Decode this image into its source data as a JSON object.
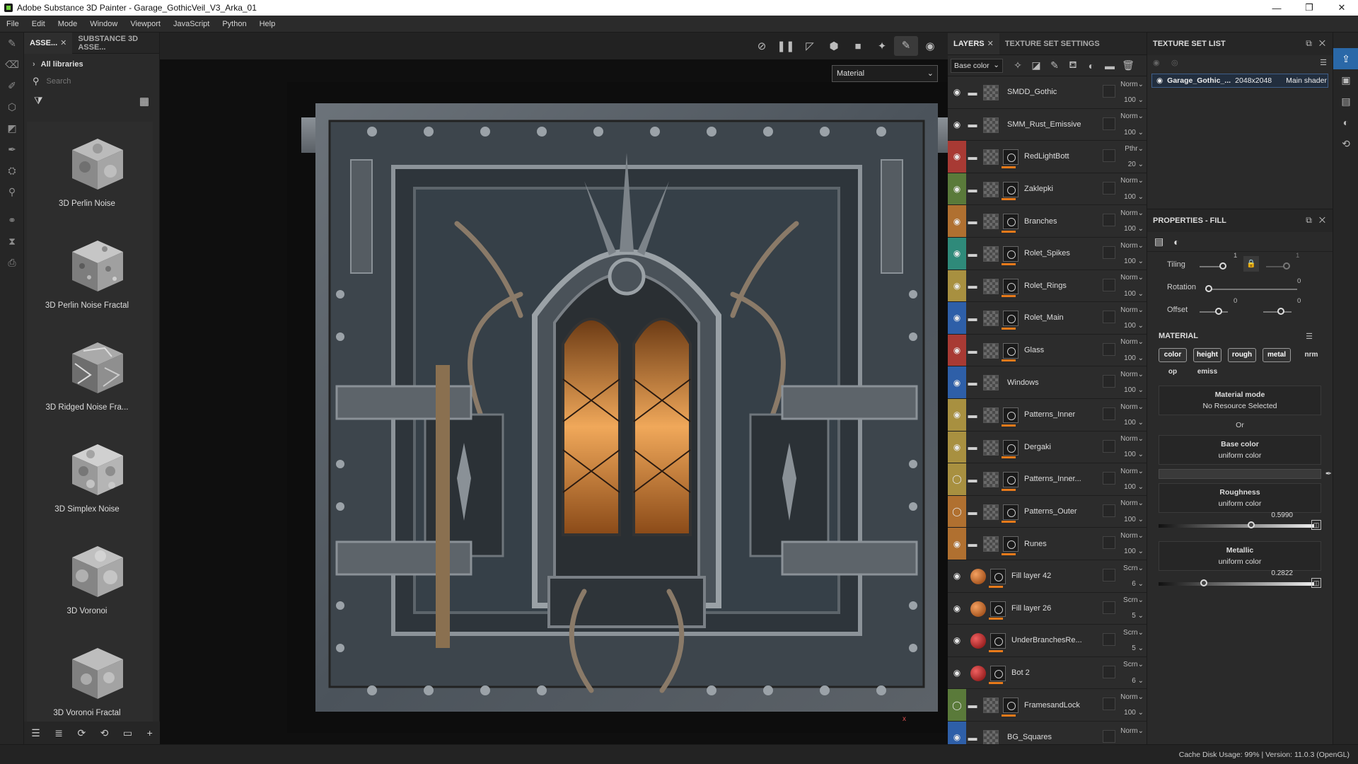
{
  "window": {
    "title": "Adobe Substance 3D Painter - Garage_GothicVeil_V3_Arka_01",
    "controls": [
      "—",
      "❐",
      "✕"
    ]
  },
  "menu": [
    "File",
    "Edit",
    "Mode",
    "Window",
    "Viewport",
    "JavaScript",
    "Python",
    "Help"
  ],
  "assets": {
    "tabs": [
      "ASSE...",
      "SUBSTANCE 3D ASSE..."
    ],
    "library": "All libraries",
    "search_placeholder": "Search",
    "items": [
      "3D Perlin Noise",
      "3D Perlin Noise Fractal",
      "3D Ridged Noise Fra...",
      "3D Simplex Noise",
      "3D Voronoi",
      "3D Voronoi Fractal"
    ]
  },
  "viewport": {
    "mode": "Material",
    "gizmo": "x"
  },
  "layers": {
    "tabs": [
      "LAYERS",
      "TEXTURE SET SETTINGS"
    ],
    "channel": "Base color",
    "rows": [
      {
        "name": "SMDD_Gothic",
        "blend": "Norm",
        "opacity": "100",
        "color": "#2c2c2c",
        "kind": "folder-open"
      },
      {
        "name": "SMM_Rust_Emissive",
        "blend": "Norm",
        "opacity": "100",
        "color": "#2c2c2c",
        "kind": "folder"
      },
      {
        "name": "RedLightBott",
        "blend": "Pthr",
        "opacity": "20",
        "color": "#a83a34",
        "kind": "folder-mask"
      },
      {
        "name": "Zaklepki",
        "blend": "Norm",
        "opacity": "100",
        "color": "#5a7a3a",
        "kind": "folder-mask"
      },
      {
        "name": "Branches",
        "blend": "Norm",
        "opacity": "100",
        "color": "#b07030",
        "kind": "folder-mask"
      },
      {
        "name": "Rolet_Spikes",
        "blend": "Norm",
        "opacity": "100",
        "color": "#2f8a7a",
        "kind": "folder-mask"
      },
      {
        "name": "Rolet_Rings",
        "blend": "Norm",
        "opacity": "100",
        "color": "#a89040",
        "kind": "folder-mask"
      },
      {
        "name": "Rolet_Main",
        "blend": "Norm",
        "opacity": "100",
        "color": "#2e5fa8",
        "kind": "folder-mask"
      },
      {
        "name": "Glass",
        "blend": "Norm",
        "opacity": "100",
        "color": "#a83a34",
        "kind": "folder-mask"
      },
      {
        "name": "Windows",
        "blend": "Norm",
        "opacity": "100",
        "color": "#2e5fa8",
        "kind": "folder"
      },
      {
        "name": "Patterns_Inner",
        "blend": "Norm",
        "opacity": "100",
        "color": "#a89040",
        "kind": "folder-mask"
      },
      {
        "name": "Dergaki",
        "blend": "Norm",
        "opacity": "100",
        "color": "#a89040",
        "kind": "folder-mask"
      },
      {
        "name": "Patterns_Inner...",
        "blend": "Norm",
        "opacity": "100",
        "color": "#a89040",
        "kind": "folder-mask-hidden"
      },
      {
        "name": "Patterns_Outer",
        "blend": "Norm",
        "opacity": "100",
        "color": "#b07030",
        "kind": "folder-mask-hidden"
      },
      {
        "name": "Runes",
        "blend": "Norm",
        "opacity": "100",
        "color": "#b07030",
        "kind": "folder-mask"
      },
      {
        "name": "Fill layer 42",
        "blend": "Scrn",
        "opacity": "6",
        "color": "#2c2c2c",
        "kind": "fill-orange"
      },
      {
        "name": "Fill layer 26",
        "blend": "Scrn",
        "opacity": "5",
        "color": "#2c2c2c",
        "kind": "fill-orange"
      },
      {
        "name": "UnderBranchesRe...",
        "blend": "Scrn",
        "opacity": "5",
        "color": "#2c2c2c",
        "kind": "fill-red"
      },
      {
        "name": "Bot 2",
        "blend": "Scrn",
        "opacity": "6",
        "color": "#2c2c2c",
        "kind": "fill-red"
      },
      {
        "name": "FramesandLock",
        "blend": "Norm",
        "opacity": "100",
        "color": "#5a7a3a",
        "kind": "folder-mask-hidden"
      },
      {
        "name": "BG_Squares",
        "blend": "Norm",
        "opacity": "",
        "color": "#2e5fa8",
        "kind": "folder"
      }
    ]
  },
  "texture_set_list": {
    "title": "TEXTURE SET LIST",
    "item": {
      "name": "Garage_Gothic_...",
      "size": "2048x2048",
      "shader": "Main shader"
    }
  },
  "properties": {
    "title": "PROPERTIES - FILL",
    "tiling": {
      "label": "Tiling",
      "value": "1",
      "value2": "1"
    },
    "rotation": {
      "label": "Rotation",
      "value": "0"
    },
    "offset": {
      "label": "Offset",
      "x": "0",
      "y": "0"
    },
    "material_title": "MATERIAL",
    "chips": [
      {
        "label": "color",
        "on": true
      },
      {
        "label": "height",
        "on": true
      },
      {
        "label": "rough",
        "on": true
      },
      {
        "label": "metal",
        "on": true
      },
      {
        "label": "nrm",
        "on": false
      },
      {
        "label": "op",
        "on": false
      },
      {
        "label": "emiss",
        "on": false
      }
    ],
    "material_mode": {
      "title": "Material mode",
      "sub": "No Resource Selected"
    },
    "or": "Or",
    "base_color": {
      "title": "Base color",
      "sub": "uniform color"
    },
    "roughness": {
      "title": "Roughness",
      "sub": "uniform color",
      "value": "0.5990",
      "level": 0.599
    },
    "metallic": {
      "title": "Metallic",
      "sub": "uniform color",
      "value": "0.2822",
      "level": 0.2822
    }
  },
  "status": "Cache Disk Usage:    99% | Version: 11.0.3 (OpenGL)"
}
